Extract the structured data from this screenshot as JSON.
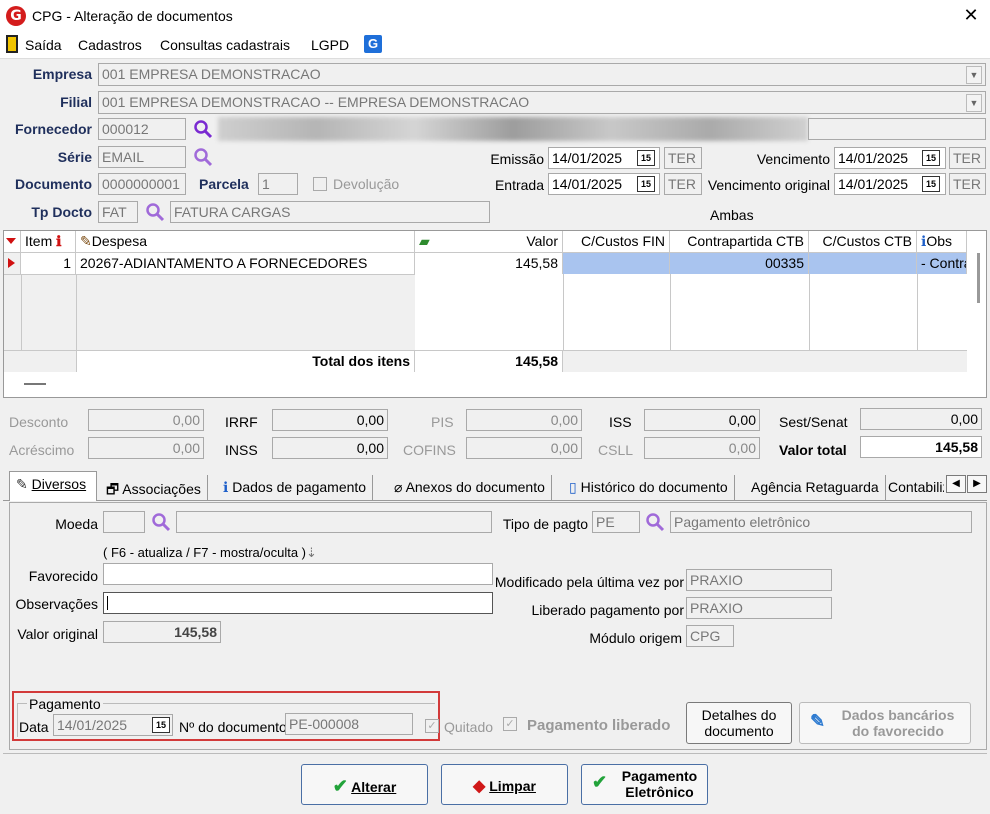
{
  "window": {
    "title": "CPG - Alteração de documentos",
    "close_glyph": "✕",
    "logo_letter": "G"
  },
  "menu": {
    "items": [
      "Saída",
      "Cadastros",
      "Consultas cadastrais",
      "LGPD"
    ],
    "lgpd_icon_letter": "G"
  },
  "header": {
    "empresa_label": "Empresa",
    "empresa_value": "001 EMPRESA DEMONSTRACAO",
    "filial_label": "Filial",
    "filial_value": "001 EMPRESA DEMONSTRACAO -- EMPRESA DEMONSTRACAO",
    "fornecedor_label": "Fornecedor",
    "fornecedor_code": "000012",
    "serie_label": "Série",
    "serie_value": "EMAIL",
    "documento_label": "Documento",
    "documento_value": "0000000001",
    "parcela_label": "Parcela",
    "parcela_value": "1",
    "devolucao_label": "Devolução",
    "tpdocto_label": "Tp Docto",
    "tpdocto_code": "FAT",
    "tpdocto_desc": "FATURA CARGAS",
    "emissao_label": "Emissão",
    "emissao_date": "14/01/2025",
    "emissao_day": "TER",
    "entrada_label": "Entrada",
    "entrada_date": "14/01/2025",
    "entrada_day": "TER",
    "vencimento_label": "Vencimento",
    "vencimento_date": "14/01/2025",
    "vencimento_day": "TER",
    "venc_original_label": "Vencimento original",
    "venc_original_date": "14/01/2025",
    "venc_original_day": "TER",
    "ambas_label": "Ambas",
    "calendar_glyph": "15"
  },
  "grid": {
    "columns": [
      "Item",
      "Despesa",
      "Valor",
      "C/Custos FIN",
      "Contrapartida CTB",
      "C/Custos CTB",
      "Obs"
    ],
    "rows": [
      {
        "item": "1",
        "despesa": "20267-ADIANTAMENTO A FORNECEDORES",
        "valor": "145,58",
        "ccustos_fin": "",
        "contrapartida": "00335",
        "ccustos_ctb": "",
        "obs": "- Contra"
      }
    ],
    "total_label": "Total dos itens",
    "total_value": "145,58"
  },
  "totals": {
    "desconto_label": "Desconto",
    "desconto": "0,00",
    "acrescimo_label": "Acréscimo",
    "acrescimo": "0,00",
    "irrf_label": "IRRF",
    "irrf": "0,00",
    "inss_label": "INSS",
    "inss": "0,00",
    "pis_label": "PIS",
    "pis": "0,00",
    "cofins_label": "COFINS",
    "cofins": "0,00",
    "iss_label": "ISS",
    "iss": "0,00",
    "csll_label": "CSLL",
    "csll": "0,00",
    "sest_label": "Sest/Senat",
    "sest": "0,00",
    "valor_total_label": "Valor total",
    "valor_total": "145,58"
  },
  "tabs": [
    "Diversos",
    "Associações",
    "Dados de pagamento",
    "Anexos do documento",
    "Histórico do documento",
    "Agência Retaguarda",
    "Contabiliz"
  ],
  "diversos": {
    "moeda_label": "Moeda",
    "f6_hint": "( F6 - atualiza / F7 - mostra/oculta )",
    "favorecido_label": "Favorecido",
    "observacoes_label": "Observações",
    "valor_original_label": "Valor original",
    "valor_original": "145,58",
    "tipo_pagto_label": "Tipo de pagto",
    "tipo_pagto_code": "PE",
    "tipo_pagto_desc": "Pagamento eletrônico",
    "modificado_label": "Modificado pela última vez por",
    "modificado_value": "PRAXIO",
    "liberado_label": "Liberado pagamento por",
    "liberado_value": "PRAXIO",
    "modulo_label": "Módulo origem",
    "modulo_value": "CPG"
  },
  "pagamento": {
    "group_label": "Pagamento",
    "data_label": "Data",
    "data_value": "14/01/2025",
    "ndoc_label": "Nº do documento",
    "ndoc_value": "PE-000008",
    "quitado_label": "Quitado",
    "liberado_label": "Pagamento liberado",
    "detalhes_button": [
      "Detalhes do",
      "documento"
    ],
    "dados_bancarios_button": [
      "Dados bancários",
      "do favorecido"
    ]
  },
  "actions": {
    "alterar": "Alterar",
    "limpar": "Limpar",
    "pagamento_eletronico": [
      "Pagamento",
      "Eletrônico"
    ]
  }
}
